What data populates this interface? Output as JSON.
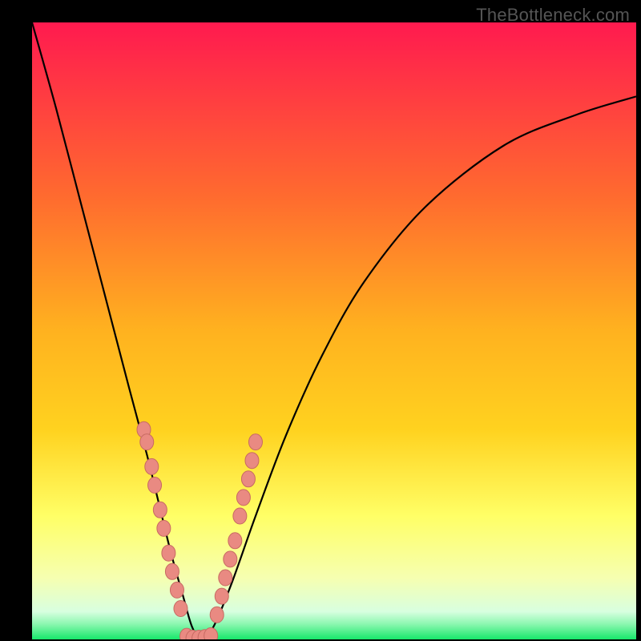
{
  "watermark": "TheBottleneck.com",
  "colors": {
    "frame": "#000000",
    "grad_top": "#ff1a4f",
    "grad_mid1": "#ff8a2a",
    "grad_mid2": "#ffd21f",
    "grad_mid3": "#ffff66",
    "grad_low": "#f6ffb0",
    "grad_bottom": "#17e86b",
    "curve": "#000000",
    "marker_fill": "#e98a82",
    "marker_stroke": "#c76a62"
  },
  "chart_data": {
    "type": "line",
    "title": "",
    "xlabel": "",
    "ylabel": "",
    "ylim": [
      0,
      100
    ],
    "xlim": [
      0,
      100
    ],
    "series": [
      {
        "name": "bottleneck-curve",
        "x": [
          0,
          4,
          8,
          12,
          16,
          19,
          21,
          23,
          25,
          26.5,
          28,
          30,
          33,
          37,
          42,
          48,
          55,
          65,
          78,
          90,
          100
        ],
        "y": [
          100,
          86,
          71,
          56,
          41,
          30,
          22,
          14,
          7,
          2,
          0,
          2,
          9,
          20,
          33,
          46,
          58,
          70,
          80,
          85,
          88
        ]
      }
    ],
    "markers": [
      {
        "x": 18.5,
        "y": 34
      },
      {
        "x": 19.0,
        "y": 32
      },
      {
        "x": 19.8,
        "y": 28
      },
      {
        "x": 20.3,
        "y": 25
      },
      {
        "x": 21.2,
        "y": 21
      },
      {
        "x": 21.8,
        "y": 18
      },
      {
        "x": 22.6,
        "y": 14
      },
      {
        "x": 23.2,
        "y": 11
      },
      {
        "x": 24.0,
        "y": 8
      },
      {
        "x": 24.6,
        "y": 5
      },
      {
        "x": 25.6,
        "y": 0.5
      },
      {
        "x": 26.6,
        "y": 0.2
      },
      {
        "x": 27.6,
        "y": 0.2
      },
      {
        "x": 28.6,
        "y": 0.3
      },
      {
        "x": 29.6,
        "y": 0.6
      },
      {
        "x": 30.6,
        "y": 4
      },
      {
        "x": 31.4,
        "y": 7
      },
      {
        "x": 32.0,
        "y": 10
      },
      {
        "x": 32.8,
        "y": 13
      },
      {
        "x": 33.6,
        "y": 16
      },
      {
        "x": 34.4,
        "y": 20
      },
      {
        "x": 35.0,
        "y": 23
      },
      {
        "x": 35.8,
        "y": 26
      },
      {
        "x": 36.4,
        "y": 29
      },
      {
        "x": 37.0,
        "y": 32
      }
    ]
  }
}
